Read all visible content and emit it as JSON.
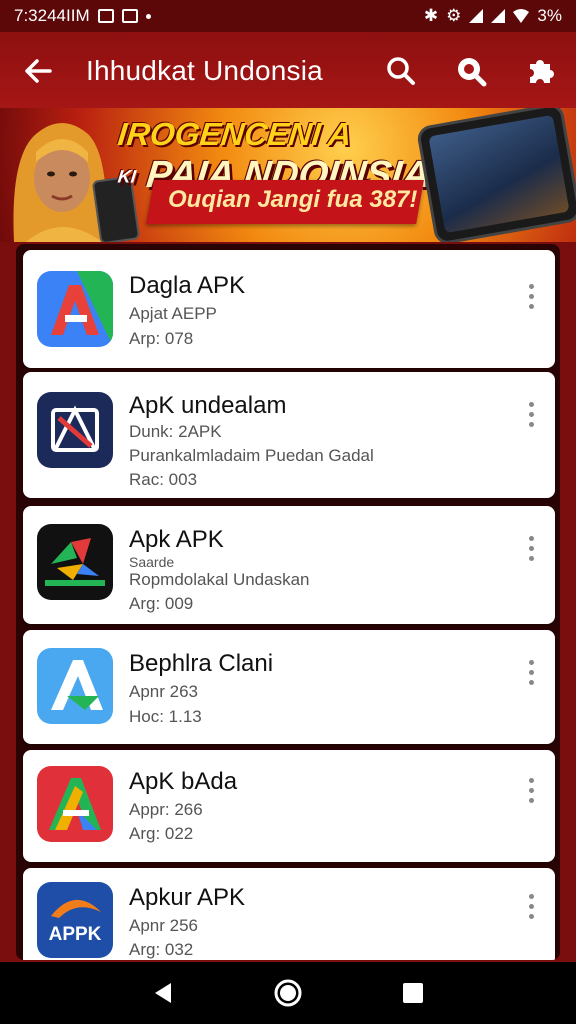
{
  "status_bar": {
    "time": "7:3244IIM",
    "battery": "3%"
  },
  "app_bar": {
    "back_icon": "back-arrow-icon",
    "title": "Ihhudkat Undonsia",
    "search_icon": "search-icon",
    "search2_icon": "search-filled-icon",
    "puzzle_icon": "puzzle-icon"
  },
  "banner": {
    "line1": "IROGENCENI A",
    "line2_prefix": "KI",
    "line2": "PAIA NDOINSIA!",
    "ribbon": "Ouqian Jangi fua 387!"
  },
  "apps": [
    {
      "name": "Dagla APK",
      "lines": [
        "Apjat AEPP",
        "Arp: 078"
      ],
      "icon": "app-icon-blue-red-a",
      "colors": {
        "a": "#e8413a",
        "b": "#3b82f6",
        "c": "#22b455"
      }
    },
    {
      "name": "ApK undealam",
      "lines": [
        "Dunk: 2APK",
        "Purankalmladaim Puedan Gadal",
        "Rac: 003"
      ],
      "icon": "app-icon-navy-frame",
      "colors": {
        "a": "#1c2a5a",
        "b": "#e23a3a",
        "c": "#ffffff"
      }
    },
    {
      "name": "Apk APK",
      "lines": [
        "Saarde",
        "Ropmdolakal Undaskan",
        "Arg: 009"
      ],
      "icon": "app-icon-black-multicolor",
      "colors": {
        "a": "#111111",
        "b": "#e23a3a",
        "c": "#22b455"
      }
    },
    {
      "name": "Bephlra Clani",
      "lines": [
        "Apnr 263",
        "Hoc: 1.13"
      ],
      "icon": "app-icon-lightblue-a",
      "colors": {
        "a": "#4aa8f0",
        "b": "#ffffff",
        "c": "#22b455"
      }
    },
    {
      "name": "ApK bAda",
      "lines": [
        "Appr: 266",
        "Arg: 022"
      ],
      "icon": "app-icon-red-rainbow-a",
      "colors": {
        "a": "#e0313a",
        "b": "#22b455",
        "c": "#3b82f6"
      }
    },
    {
      "name": "Apkur APK",
      "lines": [
        "Apnr 256",
        "Arg: 032"
      ],
      "icon": "app-icon-appk-logo",
      "icon_text": "APPK",
      "colors": {
        "a": "#1e4ea8",
        "b": "#f07d1a",
        "c": "#ffffff"
      }
    }
  ],
  "nav_bar": {
    "back_icon": "nav-back-icon",
    "home_icon": "nav-home-icon",
    "recents_icon": "nav-recents-icon"
  }
}
